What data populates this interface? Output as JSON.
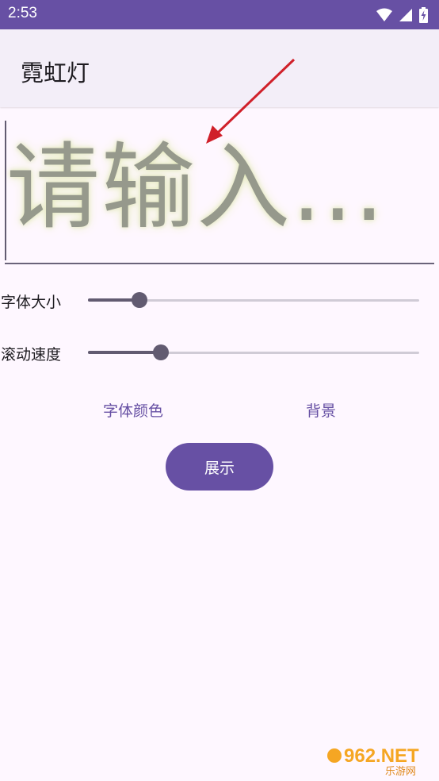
{
  "status": {
    "time": "2:53"
  },
  "app": {
    "title": "霓虹灯"
  },
  "input": {
    "placeholder": "请输入..."
  },
  "sliders": [
    {
      "label": "字体大小",
      "value": 0.155
    },
    {
      "label": "滚动速度",
      "value": 0.22
    }
  ],
  "buttons": {
    "font_color": "字体颜色",
    "background": "背景",
    "show": "展示"
  },
  "watermark": {
    "text": "962.NET",
    "sub": "乐游网"
  },
  "colors": {
    "primary": "#6750a4",
    "surface": "#fef7ff",
    "appbar": "#f3eef8",
    "slider": "#625b71",
    "annotation_arrow": "#d0202a"
  }
}
